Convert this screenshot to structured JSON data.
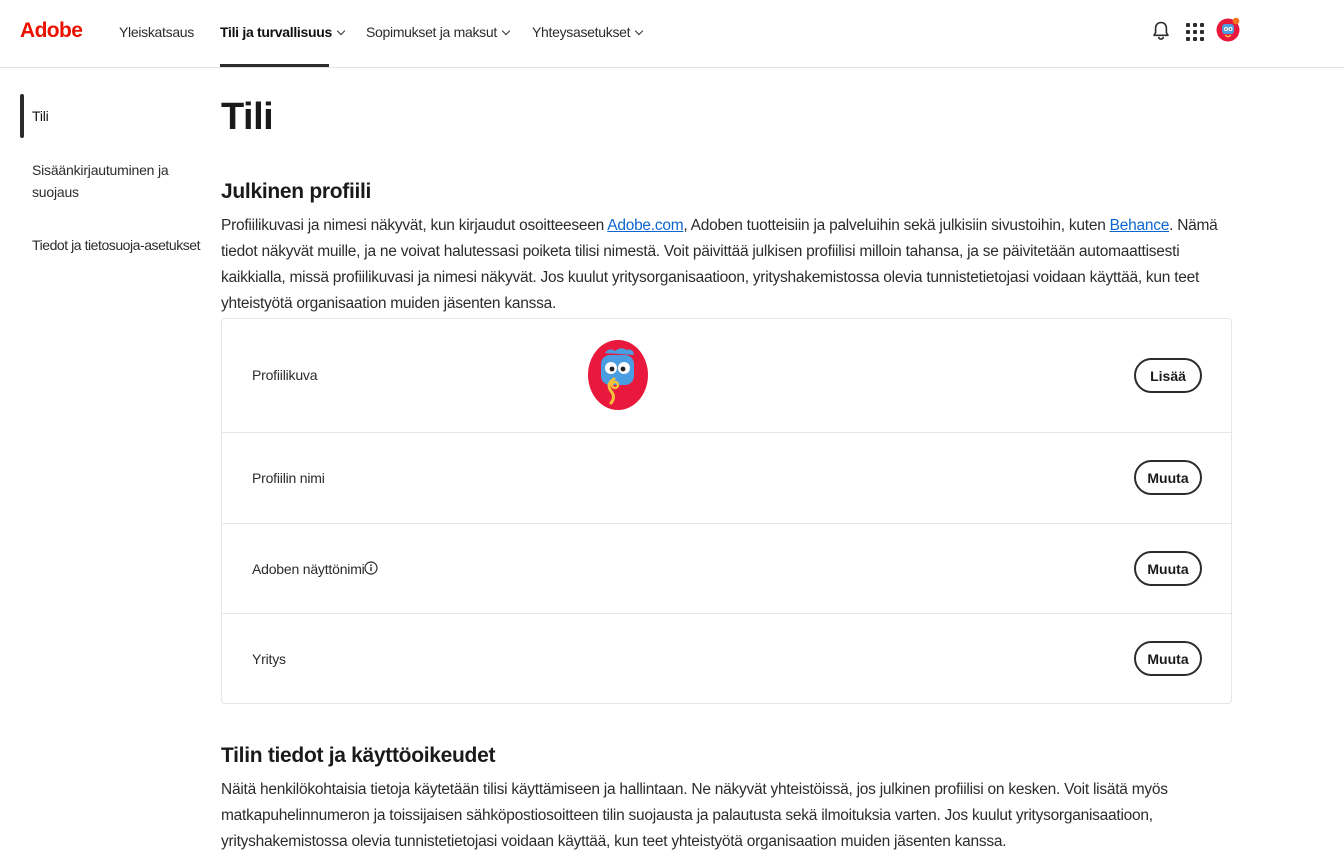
{
  "header": {
    "logo": "Adobe",
    "nav": [
      {
        "label": "Yleiskatsaus"
      },
      {
        "label": "Tili ja turvallisuus"
      },
      {
        "label": "Sopimukset ja maksut"
      },
      {
        "label": "Yhteysasetukset"
      }
    ],
    "icons": [
      "bell-icon",
      "apps-grid-icon",
      "avatar"
    ]
  },
  "sidebar": {
    "items": [
      {
        "label": "Tili"
      },
      {
        "label": "Sisäänkirjautuminen ja suojaus"
      },
      {
        "label": "Tiedot ja tietosuoja-asetukset"
      }
    ]
  },
  "main": {
    "title": "Tili",
    "public_profile": {
      "title": "Julkinen profiili",
      "desc_1": "Profiilikuvasi ja nimesi näkyvät, kun kirjaudut osoitteeseen ",
      "link_adobe": "Adobe.com",
      "desc_2": ", Adoben tuotteisiin ja palveluihin sekä julkisiin sivustoihin, kuten ",
      "link_behance": "Behance",
      "desc_3": ". Nämä tiedot näkyvät muille, ja ne voivat halutessasi poiketa tilisi nimestä. Voit päivittää julkisen profiilisi milloin tahansa, ja se päivitetään automaattisesti kaikkialla, missä profiilikuvasi ja nimesi näkyvät. Jos kuulut yritysorganisaatioon, yrityshakemistossa olevia tunnistetietojasi voidaan käyttää, kun teet yhteistyötä organisaation muiden jäsenten kanssa.",
      "rows": [
        {
          "label": "Profiilikuva",
          "button": "Lisää"
        },
        {
          "label": "Profiilin nimi",
          "button": "Muuta"
        },
        {
          "label": "Adoben näyttönimi",
          "button": "Muuta"
        },
        {
          "label": "Yritys",
          "button": "Muuta"
        }
      ]
    },
    "account_info": {
      "title": "Tilin tiedot ja käyttöoikeudet",
      "desc": "Näitä henkilökohtaisia tietoja käytetään tilisi käyttämiseen ja hallintaan. Ne näkyvät yhteistöissä, jos julkinen profiilisi on kesken. Voit lisätä myös matkapuhelinnumeron ja toissijaisen sähköpostiosoitteen tilin suojausta ja palautusta sekä ilmoituksia varten. Jos kuulut yritysorganisaatioon, yrityshakemistossa olevia tunnistetietojasi voidaan käyttää, kun teet yhteistyötä organisaation muiden jäsenten kanssa."
    }
  },
  "colors": {
    "brand": "#eb1000",
    "link": "#0d66d0",
    "text": "#2c2c2c",
    "border": "#e6e6e6"
  }
}
